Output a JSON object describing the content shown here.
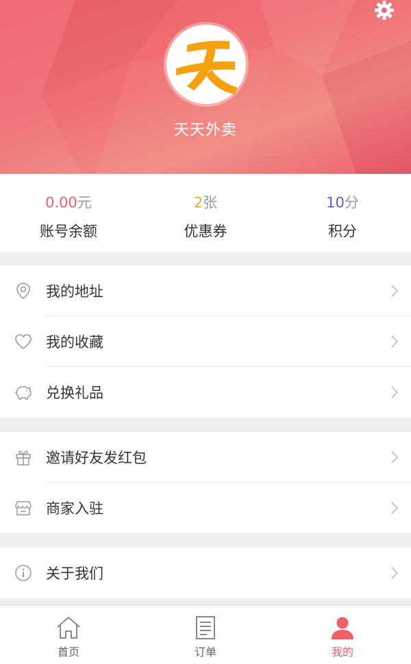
{
  "profile": {
    "name": "天天外卖",
    "logo_char": "天",
    "settings_icon": "gear-icon"
  },
  "stats": [
    {
      "value": "0.00",
      "unit": "元",
      "label": "账号余额",
      "color": "#f0606a"
    },
    {
      "value": "2",
      "unit": "张",
      "label": "优惠券",
      "color": "#f5a623"
    },
    {
      "value": "10",
      "unit": "分",
      "label": "积分",
      "color": "#5b5bd6"
    }
  ],
  "menu": {
    "group1": [
      {
        "label": "我的地址",
        "icon": "location-pin-icon"
      },
      {
        "label": "我的收藏",
        "icon": "heart-icon"
      },
      {
        "label": "兑换礼品",
        "icon": "piggy-bank-icon"
      }
    ],
    "group2": [
      {
        "label": "邀请好友发红包",
        "icon": "gift-icon"
      },
      {
        "label": "商家入驻",
        "icon": "store-icon"
      }
    ],
    "group3": [
      {
        "label": "关于我们",
        "icon": "info-icon"
      }
    ]
  },
  "tabbar": [
    {
      "label": "首页",
      "icon": "home-icon",
      "active": false
    },
    {
      "label": "订单",
      "icon": "order-list-icon",
      "active": false
    },
    {
      "label": "我的",
      "icon": "user-icon",
      "active": true
    }
  ],
  "colors": {
    "accent": "#f0606a",
    "logo_orange": "#f5a00f"
  }
}
